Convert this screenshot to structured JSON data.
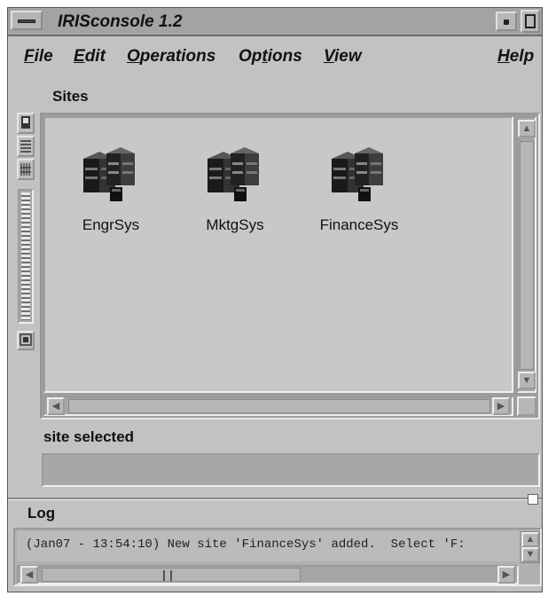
{
  "window": {
    "title": "IRISconsole 1.2"
  },
  "menubar": {
    "items": [
      {
        "mnemonic": "F",
        "rest": "ile"
      },
      {
        "mnemonic": "E",
        "rest": "dit"
      },
      {
        "mnemonic": "O",
        "rest": "perations"
      },
      {
        "mnemonic": "",
        "rest": "Op",
        "mnemonic2": "t",
        "rest2": "ions"
      },
      {
        "mnemonic": "V",
        "rest": "iew"
      },
      {
        "mnemonic": "H",
        "rest": "elp"
      }
    ]
  },
  "sites": {
    "label": "Sites",
    "items": [
      {
        "name": "EngrSys",
        "icon": "server-site-icon"
      },
      {
        "name": "MktgSys",
        "icon": "server-site-icon"
      },
      {
        "name": "FinanceSys",
        "icon": "server-site-icon"
      }
    ]
  },
  "status": {
    "label": "site selected",
    "value": ""
  },
  "log": {
    "label": "Log",
    "text": "(Jan07 - 13:54:10) New site 'FinanceSys' added.  Select 'F:"
  }
}
